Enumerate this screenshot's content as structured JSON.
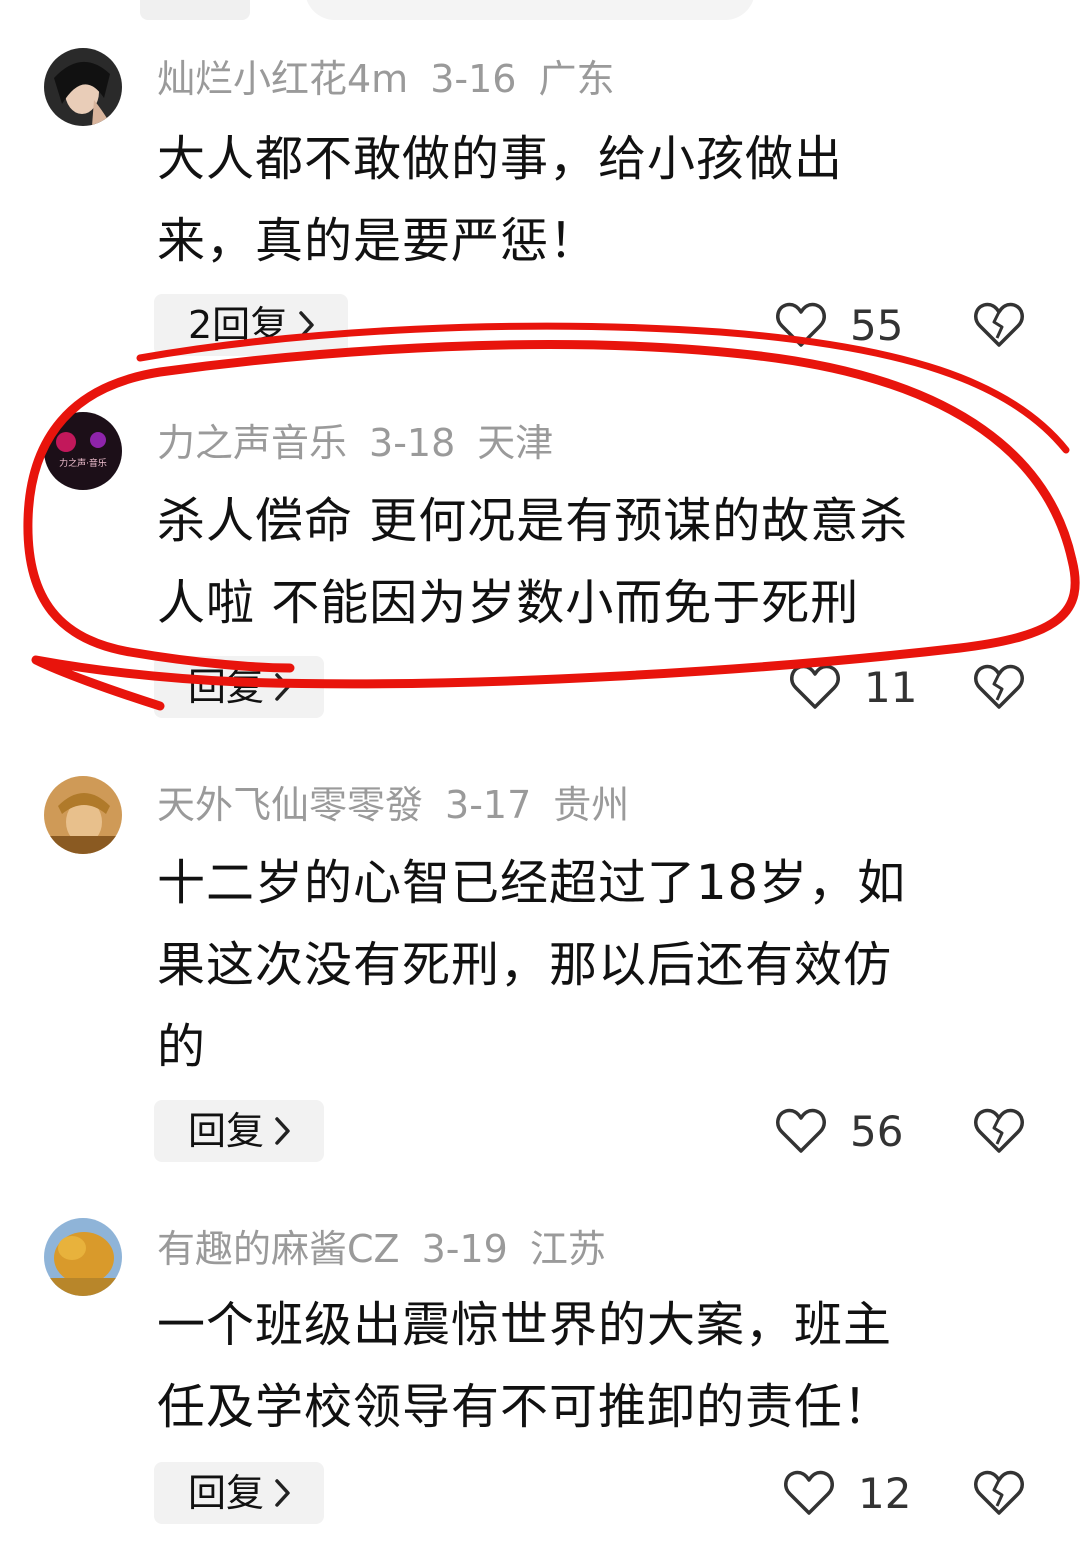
{
  "comments": [
    {
      "username": "灿烂小红花4m",
      "date": "3-16",
      "location": "广东",
      "text_lines": [
        "大人都不敢做的事，给小孩做出",
        "来，真的是要严惩！"
      ],
      "reply_label": "2回复",
      "likes": "55"
    },
    {
      "username": "力之声音乐",
      "date": "3-18",
      "location": "天津",
      "text_lines": [
        "杀人偿命 更何况是有预谋的故意杀",
        "人啦 不能因为岁数小而免于死刑"
      ],
      "reply_label": "回复",
      "likes": "11",
      "avatar_text": "力之声·音乐"
    },
    {
      "username": "天外飞仙零零發",
      "date": "3-17",
      "location": "贵州",
      "text_lines": [
        "十二岁的心智已经超过了18岁，如",
        "果这次没有死刑，那以后还有效仿",
        "的"
      ],
      "reply_label": "回复",
      "likes": "56"
    },
    {
      "username": "有趣的麻酱CZ",
      "date": "3-19",
      "location": "江苏",
      "text_lines": [
        "一个班级出震惊世界的大案，班主",
        "任及学校领导有不可推卸的责任！"
      ],
      "reply_label": "回复",
      "likes": "12"
    }
  ],
  "icons": {
    "like": "heart-outline-icon",
    "dislike": "broken-heart-icon",
    "reply_chevron": "chevron-right-icon"
  },
  "colors": {
    "annotation": "#e8140c",
    "meta_text": "#9a9a9a",
    "reply_bg": "#f2f2f2"
  }
}
